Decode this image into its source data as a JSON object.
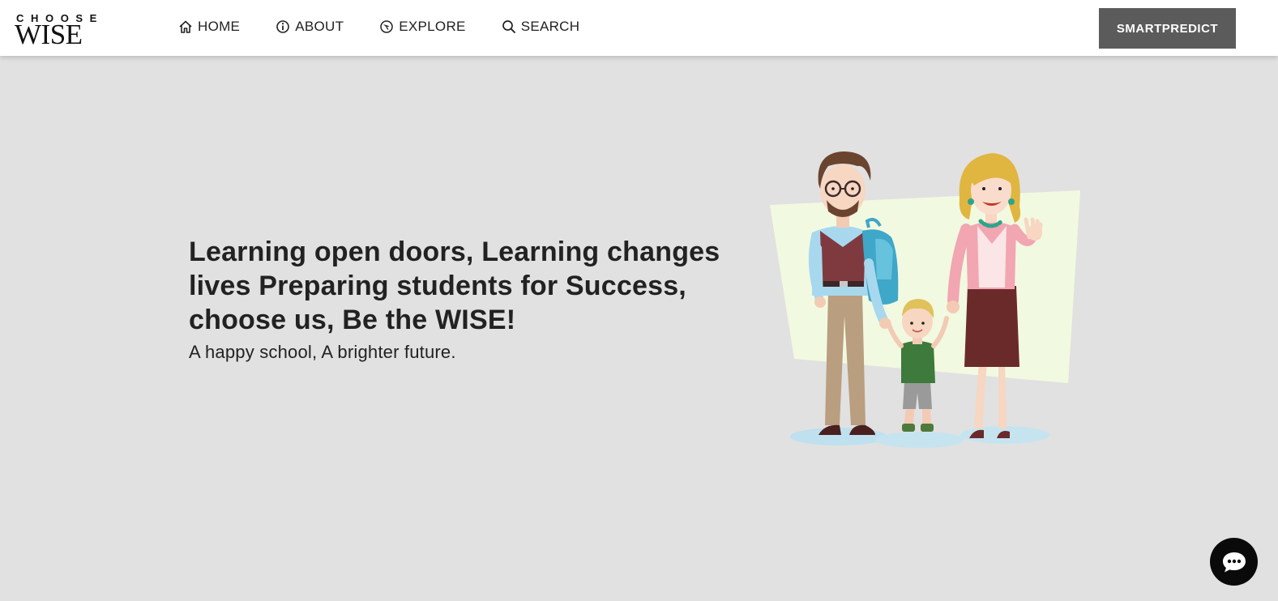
{
  "brand": {
    "logo_top": "CHOOSE",
    "logo_bottom": "WISE"
  },
  "nav": {
    "items": [
      {
        "label": "HOME",
        "icon": "home-icon"
      },
      {
        "label": "ABOUT",
        "icon": "info-icon"
      },
      {
        "label": "EXPLORE",
        "icon": "compass-icon"
      },
      {
        "label": "SEARCH",
        "icon": "search-icon"
      }
    ]
  },
  "cta": {
    "label": "SMARTPREDICT"
  },
  "hero": {
    "headline": "Learning open doors, Learning changes lives Preparing students for Success, choose us, Be the WISE!",
    "tagline": "A happy school, A brighter future.",
    "illustration": "family-illustration"
  },
  "chat": {
    "icon": "chat-bubble-icon"
  },
  "colors": {
    "background": "#e1e1e1",
    "navbar": "#ffffff",
    "cta": "#5b5b5b",
    "chat": "#0a0a0a"
  }
}
